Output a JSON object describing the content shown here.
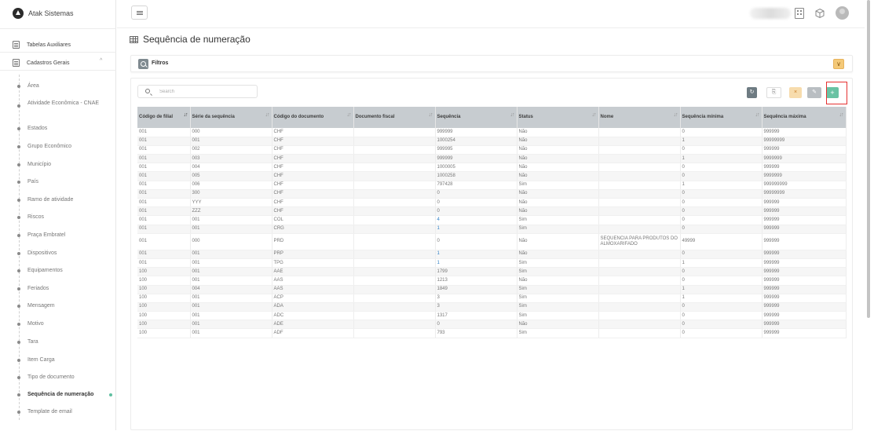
{
  "app": {
    "name": "Atak Sistemas"
  },
  "sidebar": {
    "groups": [
      {
        "label": "Tabelas Auxiliares"
      },
      {
        "label": "Cadastros Gerais",
        "chevron": "^"
      }
    ],
    "items": [
      {
        "label": "Área"
      },
      {
        "label": "Atividade Econômica - CNAE"
      },
      {
        "label": "Estados"
      },
      {
        "label": "Grupo Econômico"
      },
      {
        "label": "Município"
      },
      {
        "label": "País"
      },
      {
        "label": "Ramo de atividade"
      },
      {
        "label": "Riscos"
      },
      {
        "label": "Praça Embratel"
      },
      {
        "label": "Dispositivos"
      },
      {
        "label": "Equipamentos"
      },
      {
        "label": "Feriados"
      },
      {
        "label": "Mensagem"
      },
      {
        "label": "Motivo"
      },
      {
        "label": "Tara"
      },
      {
        "label": "Item Carga"
      },
      {
        "label": "Tipo de documento"
      },
      {
        "label": "Sequência de numeração",
        "active": true
      },
      {
        "label": "Template de email"
      }
    ]
  },
  "page": {
    "title": "Sequência de numeração"
  },
  "filters": {
    "label": "Filtros",
    "chevron": "∨"
  },
  "toolbar": {
    "search_placeholder": "Search",
    "refresh_icon": "refresh-icon",
    "refresh_label": "↻",
    "export_label": "⎘",
    "delete_label": "×",
    "edit_label": "✎",
    "add_label": "+"
  },
  "table": {
    "headers": [
      "Código de filial",
      "Série da sequência",
      "Código do documento",
      "Documento fiscal",
      "Sequência",
      "Status",
      "Nome",
      "Sequência mínima",
      "Sequência máxima"
    ],
    "rows": [
      [
        "001",
        "000",
        "CHF",
        "",
        "999999",
        "Não",
        "",
        "0",
        "999999"
      ],
      [
        "001",
        "001",
        "CHF",
        "",
        "1000254",
        "Não",
        "",
        "1",
        "99999999"
      ],
      [
        "001",
        "002",
        "CHF",
        "",
        "999995",
        "Não",
        "",
        "0",
        "999999"
      ],
      [
        "001",
        "003",
        "CHF",
        "",
        "999999",
        "Não",
        "",
        "1",
        "9999999"
      ],
      [
        "001",
        "004",
        "CHF",
        "",
        "1000005",
        "Não",
        "",
        "0",
        "999999"
      ],
      [
        "001",
        "005",
        "CHF",
        "",
        "1000258",
        "Não",
        "",
        "0",
        "9999999"
      ],
      [
        "001",
        "006",
        "CHF",
        "",
        "797428",
        "Sim",
        "",
        "1",
        "999999999"
      ],
      [
        "001",
        "300",
        "CHF",
        "",
        "0",
        "Não",
        "",
        "0",
        "99999999"
      ],
      [
        "001",
        "YYY",
        "CHF",
        "",
        "0",
        "Não",
        "",
        "0",
        "999999"
      ],
      [
        "001",
        "ZZZ",
        "CHF",
        "",
        "0",
        "Não",
        "",
        "0",
        "999999"
      ],
      [
        "001",
        "001",
        "COL",
        "",
        "4",
        "Sim",
        "",
        "0",
        "999999"
      ],
      [
        "001",
        "001",
        "CRG",
        "",
        "1",
        "Sim",
        "",
        "0",
        "999999"
      ],
      [
        "001",
        "000",
        "PRD",
        "",
        "0",
        "Não",
        "SEQUENCIA PARA PRODUTOS DO ALMOXARIFADO",
        "49999",
        "999999"
      ],
      [
        "001",
        "001",
        "PRP",
        "",
        "1",
        "Não",
        "",
        "0",
        "999999"
      ],
      [
        "001",
        "001",
        "TPG",
        "",
        "1",
        "Sim",
        "",
        "1",
        "999999"
      ],
      [
        "100",
        "001",
        "AAE",
        "",
        "1799",
        "Sim",
        "",
        "0",
        "999999"
      ],
      [
        "100",
        "001",
        "AAS",
        "",
        "1213",
        "Não",
        "",
        "0",
        "999999"
      ],
      [
        "100",
        "004",
        "AAS",
        "",
        "1849",
        "Sim",
        "",
        "1",
        "999999"
      ],
      [
        "100",
        "001",
        "ACP",
        "",
        "3",
        "Sim",
        "",
        "1",
        "999999"
      ],
      [
        "100",
        "001",
        "ADA",
        "",
        "3",
        "Sim",
        "",
        "0",
        "999999"
      ],
      [
        "100",
        "001",
        "ADC",
        "",
        "1317",
        "Sim",
        "",
        "0",
        "999999"
      ],
      [
        "100",
        "001",
        "ADE",
        "",
        "0",
        "Não",
        "",
        "0",
        "999999"
      ],
      [
        "100",
        "001",
        "ADF",
        "",
        "793",
        "Sim",
        "",
        "0",
        "999999"
      ]
    ]
  },
  "colors": {
    "accent_green": "#69c2a3",
    "link_blue": "#2f80c6",
    "highlight_red": "#e53030"
  }
}
